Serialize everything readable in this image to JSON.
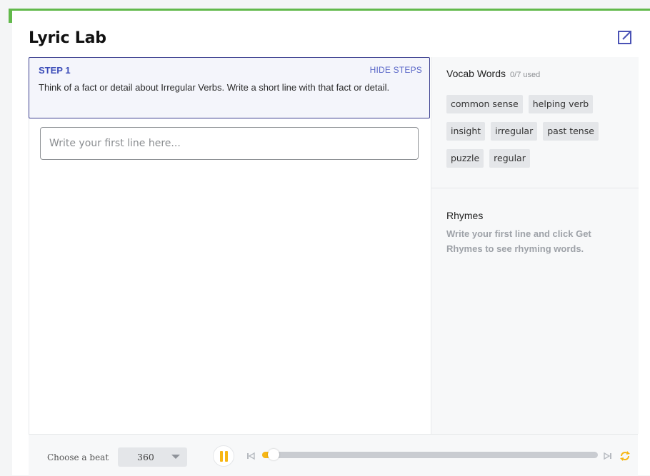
{
  "app": {
    "title": "Lyric Lab",
    "accent_color": "#62b94b",
    "highlight_color": "#f7b614"
  },
  "step": {
    "title": "STEP 1",
    "hide_label": "HIDE STEPS",
    "text": "Think of a fact or detail about Irregular Verbs. Write a short line with that fact or detail."
  },
  "lyric_input": {
    "placeholder": "Write your first line here...",
    "value": ""
  },
  "vocab": {
    "title": "Vocab Words",
    "used": "0/7 used",
    "words": [
      "common sense",
      "helping verb",
      "insight",
      "irregular",
      "past tense",
      "puzzle",
      "regular"
    ]
  },
  "rhymes": {
    "title": "Rhymes",
    "text": "Write your first line and click Get Rhymes to see rhyming words."
  },
  "player": {
    "beat_label": "Choose a beat",
    "beat_value": "360",
    "progress": 0.02,
    "state": "playing",
    "icons": [
      "pause-icon",
      "skip-back-icon",
      "skip-forward-icon",
      "loop-icon"
    ]
  }
}
